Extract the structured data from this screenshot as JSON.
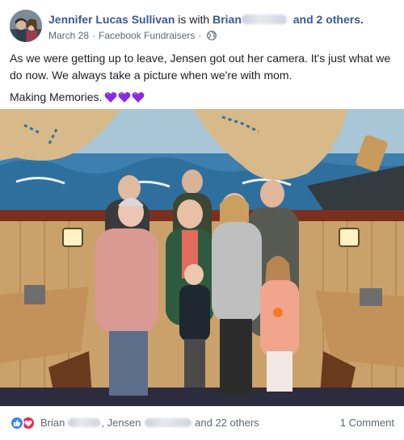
{
  "post": {
    "author": "Jennifer Lucas Sullivan",
    "with_prefix": "is with",
    "tagged_first": "Brian",
    "tagged_suffix": "and 2 others.",
    "date": "March 28",
    "separator": "·",
    "source": "Facebook Fundraisers",
    "privacy_icon": "globe-icon",
    "text_line1": "As we were getting up to leave, Jensen got out her camera. It's just what we do now. We always take a picture when we're with mom.",
    "text_line2": "Making Memories.",
    "emoji": [
      "purple-heart",
      "purple-heart",
      "purple-heart"
    ]
  },
  "footer": {
    "reaction_icons": [
      "like-icon",
      "love-icon"
    ],
    "reactor1": "Brian",
    "reactor2": "Jensen",
    "others": "and 22 others",
    "comments": "1 Comment"
  },
  "colors": {
    "link": "#385898",
    "meta": "#606770",
    "like": "#3b82f6",
    "love": "#f0284a",
    "heart": "#8a2be2"
  }
}
